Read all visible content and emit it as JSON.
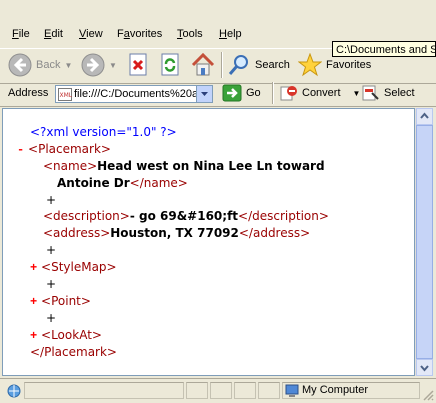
{
  "menu": [
    {
      "accel": "F",
      "rest": "ile"
    },
    {
      "accel": "E",
      "rest": "dit"
    },
    {
      "accel": "V",
      "rest": "iew"
    },
    {
      "accel": "F",
      "pre": "",
      "rest": "avorites",
      "label": "Favorites"
    },
    {
      "accel": "T",
      "rest": "ools"
    },
    {
      "accel": "H",
      "rest": "elp"
    }
  ],
  "tooltip": "C:\\Documents and Se",
  "toolbar": {
    "back_label": "Back",
    "search_label": "Search",
    "favorites_label": "Favorites"
  },
  "address": {
    "label": "Address",
    "value": "file:///C:/Documents%20a",
    "go_label": "Go",
    "convert_label": "Convert",
    "select_label": "Select"
  },
  "xml": {
    "pi": "<?xml version=\"1.0\" ?>",
    "placemark_open": "<Placemark>",
    "name_open": "<name>",
    "name_value_1": "Head west on Nina Lee Ln toward",
    "name_value_2": "Antoine Dr",
    "name_close": "</name>",
    "plus": "+",
    "desc_open": "<description>",
    "desc_value": "- go 69&#160;ft",
    "desc_close": "</description>",
    "address_open": "<address>",
    "address_value": "Houston, TX 77092",
    "address_close": "</address>",
    "stylemap": "<StyleMap>",
    "point": "<Point>",
    "lookat": "<LookAt>",
    "placemark_close": "</Placemark>",
    "collapse": "-",
    "expand": "+"
  },
  "status": {
    "zone": "My Computer"
  }
}
